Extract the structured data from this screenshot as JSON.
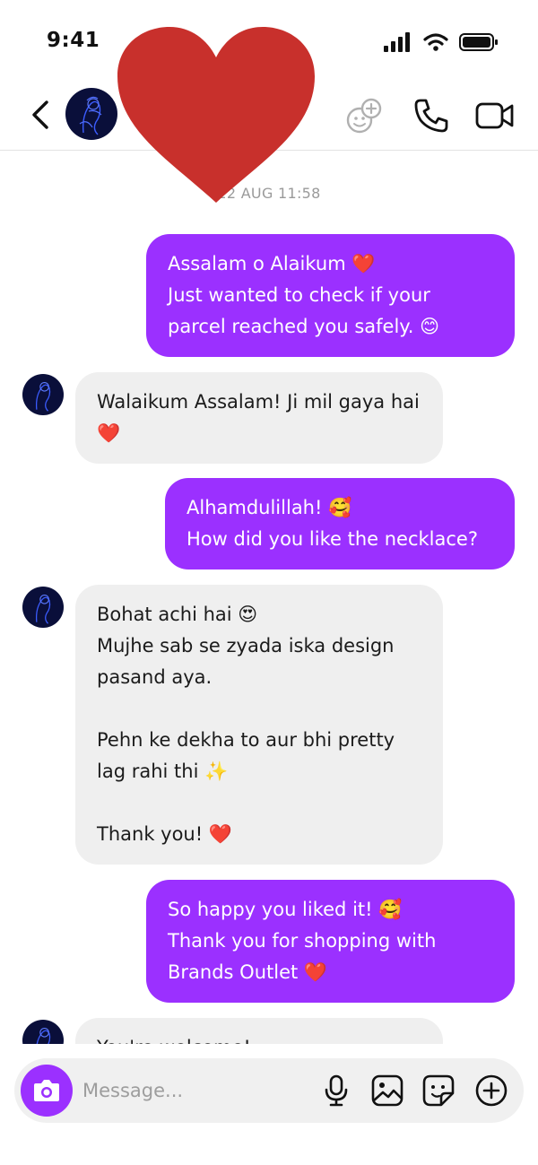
{
  "status_bar": {
    "time": "9:41",
    "icons": [
      "signal-icon",
      "wifi-icon",
      "battery-icon"
    ]
  },
  "header": {
    "back_icon": "chevron-left-icon",
    "subtext": "·",
    "actions": [
      "effects-icon",
      "phone-icon",
      "video-camera-icon"
    ]
  },
  "conversation": {
    "timestamp": "22 AUG 11:58",
    "messages": [
      {
        "direction": "outgoing",
        "text": "Assalam o Alaikum ❤️\nJust wanted to check if your\nparcel reached you safely. 😊"
      },
      {
        "direction": "incoming",
        "text": "Walaikum Assalam! Ji mil gaya hai\n❤️"
      },
      {
        "direction": "outgoing",
        "text": "Alhamdulillah! 🥰\nHow did you like the necklace?"
      },
      {
        "direction": "incoming",
        "text": "Bohat achi hai 😍\nMujhe sab se zyada iska design\npasand aya.\n\nPehn ke dekha to aur bhi pretty\nlag rahi thi ✨\n\nThank you! ❤️"
      },
      {
        "direction": "outgoing",
        "text": "So happy you liked it! 🥰\nThank you for shopping with\nBrands Outlet ❤️"
      },
      {
        "direction": "incoming",
        "text": "You're welcome!"
      }
    ]
  },
  "composer": {
    "placeholder": "Message...",
    "icons": [
      "camera-icon",
      "microphone-icon",
      "gallery-icon",
      "sticker-icon",
      "plus-circle-icon"
    ]
  },
  "colors": {
    "accent": "#9b30ff",
    "incoming_bubble": "#efefef",
    "heart_overlay": "#c8302c"
  }
}
